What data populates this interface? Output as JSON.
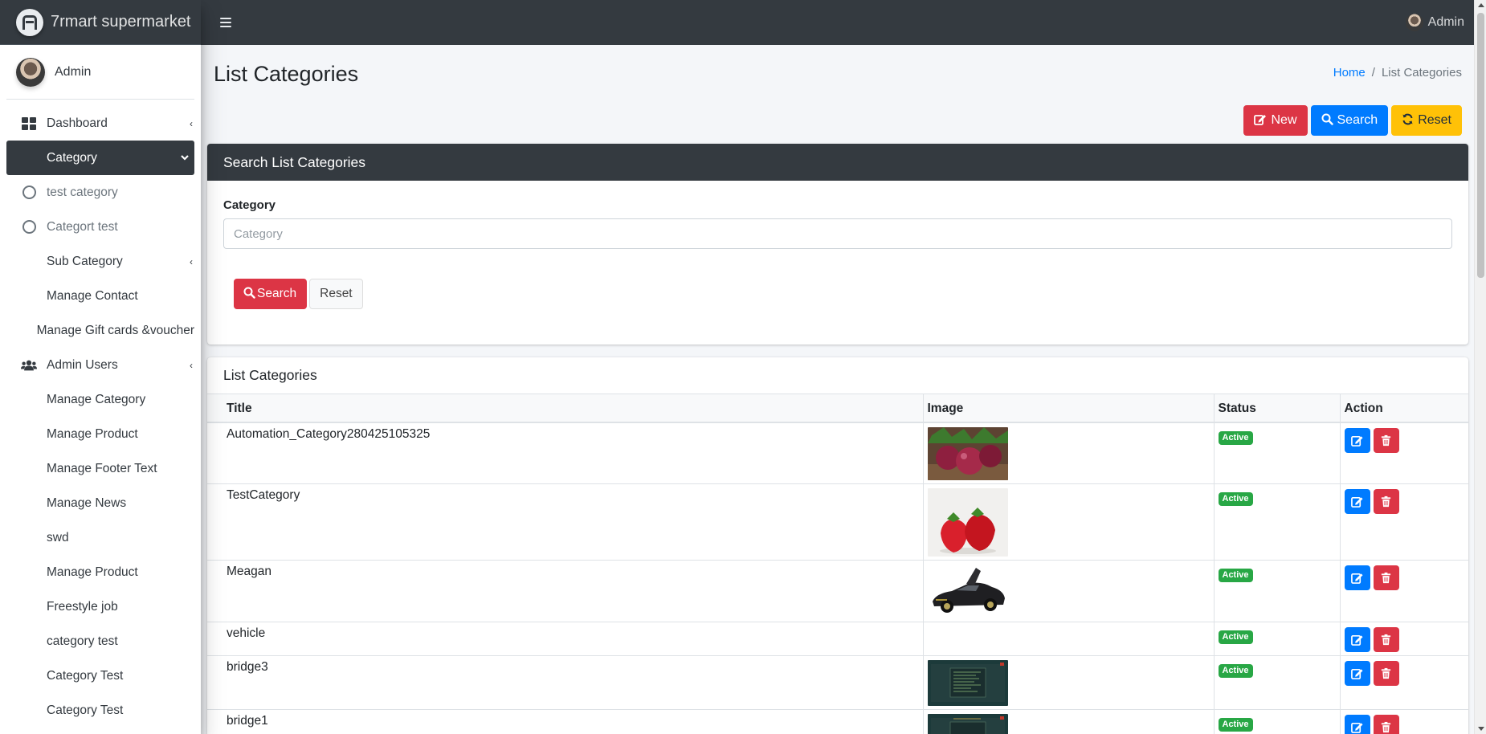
{
  "brand": {
    "name": "7rmart supermarket"
  },
  "topbar": {
    "user_label": "Admin"
  },
  "sidebar": {
    "user_name": "Admin",
    "items": [
      {
        "label": "Dashboard"
      },
      {
        "label": "Category"
      },
      {
        "label": "test category"
      },
      {
        "label": "Categort test"
      },
      {
        "label": "Sub Category"
      },
      {
        "label": "Manage Contact"
      },
      {
        "label": "Manage Gift cards &voucher"
      },
      {
        "label": "Admin Users"
      },
      {
        "label": "Manage Category"
      },
      {
        "label": "Manage Product"
      },
      {
        "label": "Manage Footer Text"
      },
      {
        "label": "Manage News"
      },
      {
        "label": "swd"
      },
      {
        "label": "Manage Product"
      },
      {
        "label": "Freestyle job"
      },
      {
        "label": "category test"
      },
      {
        "label": "Category Test"
      },
      {
        "label": "Category Test"
      }
    ]
  },
  "page": {
    "title": "List Categories",
    "breadcrumb": {
      "home": "Home",
      "separator": "/",
      "current": "List Categories"
    },
    "actions": {
      "new": "New",
      "search": "Search",
      "reset": "Reset"
    }
  },
  "search_card": {
    "title": "Search List Categories",
    "field_label": "Category",
    "placeholder": "Category",
    "value": "",
    "search_button": "Search",
    "reset_button": "Reset"
  },
  "list": {
    "title": "List Categories",
    "columns": [
      "Title",
      "Image",
      "Status",
      "Action"
    ],
    "rows": [
      {
        "title": "Automation_Category280425105325",
        "image": "beetroot",
        "status": "Active"
      },
      {
        "title": "TestCategory",
        "image": "strawberries",
        "status": "Active"
      },
      {
        "title": "Meagan",
        "image": "sports-car",
        "status": "Active"
      },
      {
        "title": "vehicle",
        "image": "",
        "status": "Active"
      },
      {
        "title": "bridge3",
        "image": "screenshot",
        "status": "Active"
      },
      {
        "title": "bridge1",
        "image": "screenshot",
        "status": "Active"
      }
    ]
  },
  "colors": {
    "dark": "#343a40",
    "primary": "#007bff",
    "danger": "#dc3545",
    "warning": "#ffc107",
    "success": "#28a745"
  }
}
